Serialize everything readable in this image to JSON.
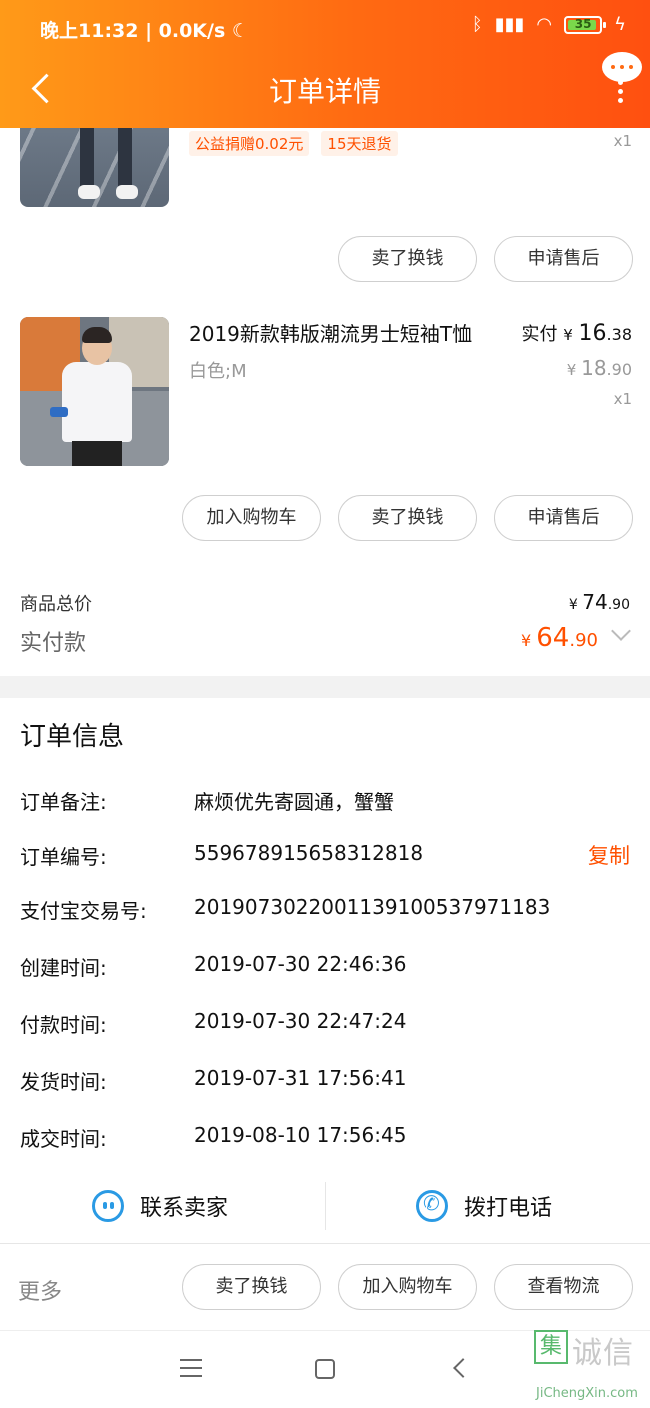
{
  "status_bar": {
    "text": "晚上11:32 | 0.0K/s ☾",
    "battery": "35"
  },
  "header": {
    "title": "订单详情"
  },
  "item1": {
    "tags": [
      "公益捐赠0.02元",
      "15天退货"
    ],
    "qty": "x1",
    "buttons": [
      "卖了换钱",
      "申请售后"
    ]
  },
  "item2": {
    "title": "2019新款韩版潮流男士短袖T恤",
    "sku": "白色;M",
    "paid_label": "实付",
    "paid_currency": "¥",
    "paid_int": "16",
    "paid_dec": ".38",
    "orig_currency": "¥",
    "orig_int": "18",
    "orig_dec": ".90",
    "qty": "x1",
    "buttons": [
      "加入购物车",
      "卖了换钱",
      "申请售后"
    ]
  },
  "summary": {
    "total_label": "商品总价",
    "total_currency": "¥",
    "total_int": "74",
    "total_dec": ".90",
    "paid_label": "实付款",
    "paid_currency": "¥",
    "paid_int": "64",
    "paid_dec": ".90"
  },
  "order_info": {
    "title": "订单信息",
    "rows": [
      {
        "key": "订单备注:",
        "value": "麻烦优先寄圆通，蟹蟹"
      },
      {
        "key": "订单编号:",
        "value": "559678915658312818"
      },
      {
        "key": "支付宝交易号:",
        "value": "2019073022001139100537971183"
      },
      {
        "key": "创建时间:",
        "value": "2019-07-30 22:46:36"
      },
      {
        "key": "付款时间:",
        "value": "2019-07-30 22:47:24"
      },
      {
        "key": "发货时间:",
        "value": "2019-07-31 17:56:41"
      },
      {
        "key": "成交时间:",
        "value": "2019-08-10 17:56:45"
      }
    ],
    "copy_label": "复制"
  },
  "contact": {
    "seller_label": "联系卖家",
    "call_label": "拨打电话"
  },
  "footer": {
    "more_label": "更多",
    "buttons": [
      "卖了换钱",
      "加入购物车",
      "查看物流"
    ]
  },
  "watermark": {
    "box_char": "集",
    "cn": "诚信",
    "en": "JiChengXin.com"
  },
  "colors": {
    "accent": "#ff5000",
    "header_start": "#ff9a18",
    "header_end": "#ff5010",
    "icon_blue": "#2a9ae4"
  }
}
